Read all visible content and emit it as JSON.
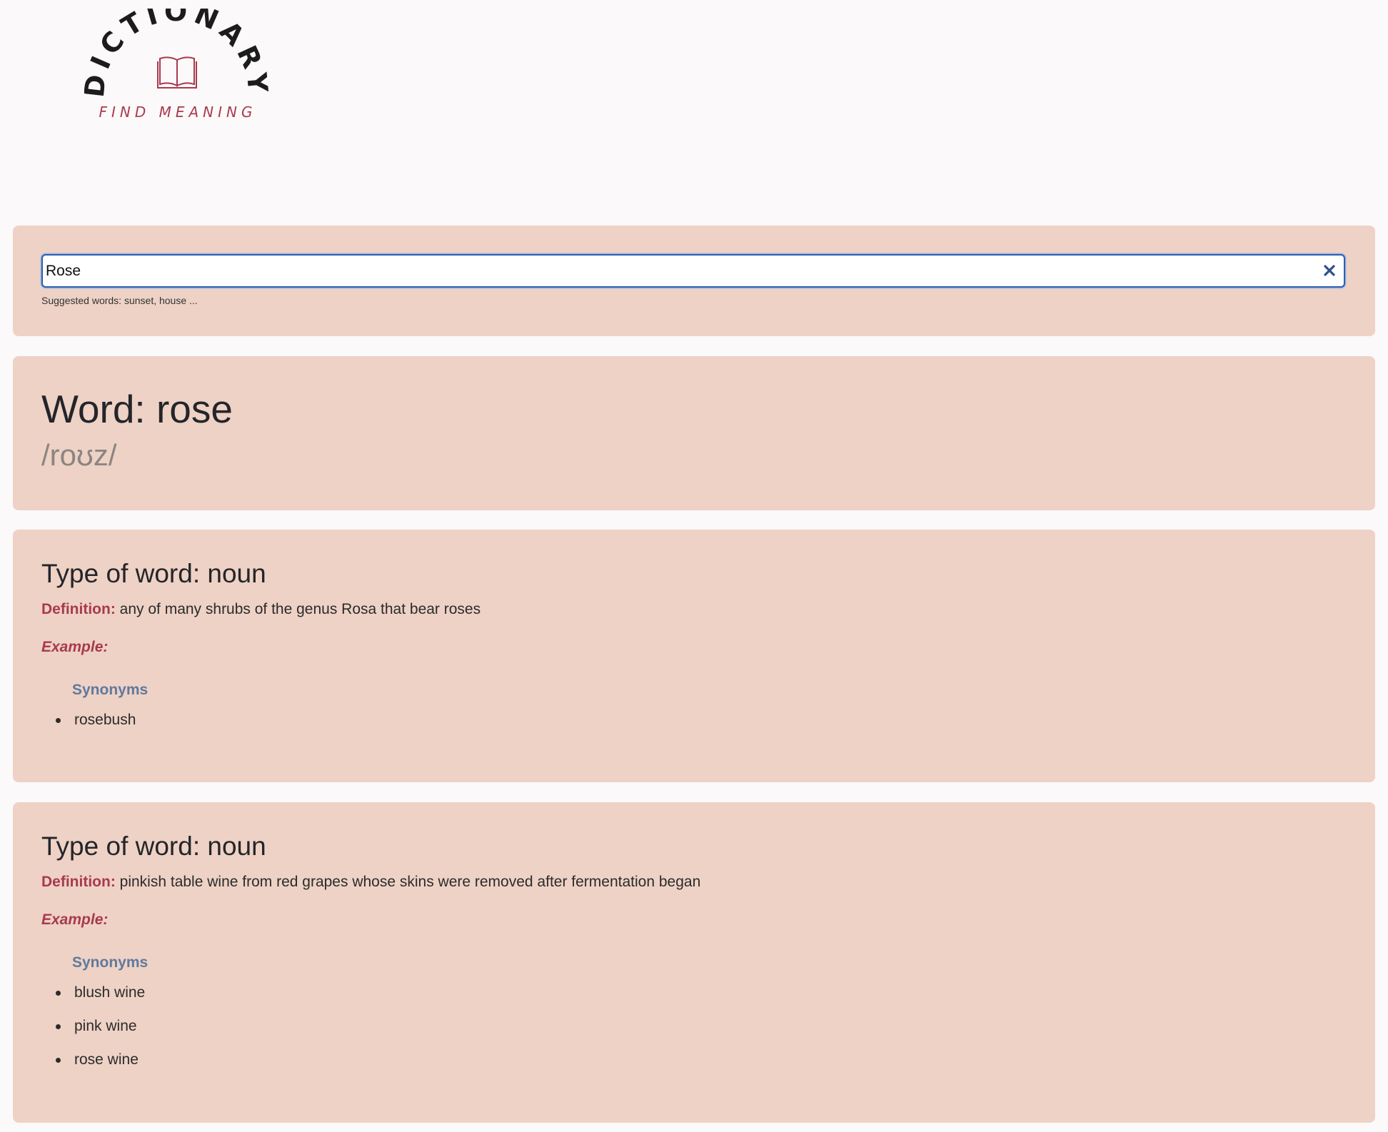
{
  "logo": {
    "title": "DICTIONARY",
    "tagline": "FIND MEANING",
    "icon": "open-book-icon",
    "title_color": "#1c1c1c",
    "accent_color": "#a83a4f"
  },
  "search": {
    "value": "Rose",
    "clear_icon": "close-icon",
    "suggestion_text": "Suggested words: sunset, house ..."
  },
  "word": {
    "heading": "Word: rose",
    "phonetic": "/roʊz/"
  },
  "senses": [
    {
      "type_heading": "Type of word: noun",
      "definition_label": "Definition:",
      "definition": "any of many shrubs of the genus Rosa that bear roses",
      "example_label": "Example:",
      "synonyms_heading": "Synonyms",
      "synonyms": [
        "rosebush"
      ]
    },
    {
      "type_heading": "Type of word: noun",
      "definition_label": "Definition:",
      "definition": "pinkish table wine from red grapes whose skins were removed after fermentation began",
      "example_label": "Example:",
      "synonyms_heading": "Synonyms",
      "synonyms": [
        "blush wine",
        "pink wine",
        "rose wine"
      ]
    }
  ],
  "colors": {
    "page_background": "#fbf9f9",
    "card_background": "#eed2c5",
    "label_red": "#a83a4f",
    "synonyms_blue": "#60799c",
    "focus_border": "#2f5fae"
  }
}
